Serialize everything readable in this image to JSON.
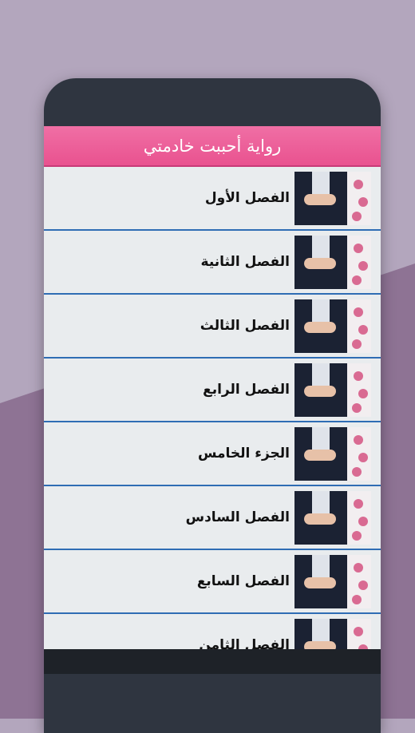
{
  "app": {
    "title": "رواية أحببت خادمتي"
  },
  "chapters": [
    {
      "label": "الفصل الأول"
    },
    {
      "label": "الفصل الثانية"
    },
    {
      "label": "الفصل الثالث"
    },
    {
      "label": "الفصل الرابع"
    },
    {
      "label": "الجزء الخامس"
    },
    {
      "label": "الفصل السادس"
    },
    {
      "label": "الفصل السابع"
    },
    {
      "label": "الفصل الثامن"
    }
  ],
  "colors": {
    "header": "#e9528f",
    "divider": "#2f6db4",
    "background": "#b3a6bd"
  },
  "icons": {
    "thumbnail": "wedding-couple-image"
  }
}
